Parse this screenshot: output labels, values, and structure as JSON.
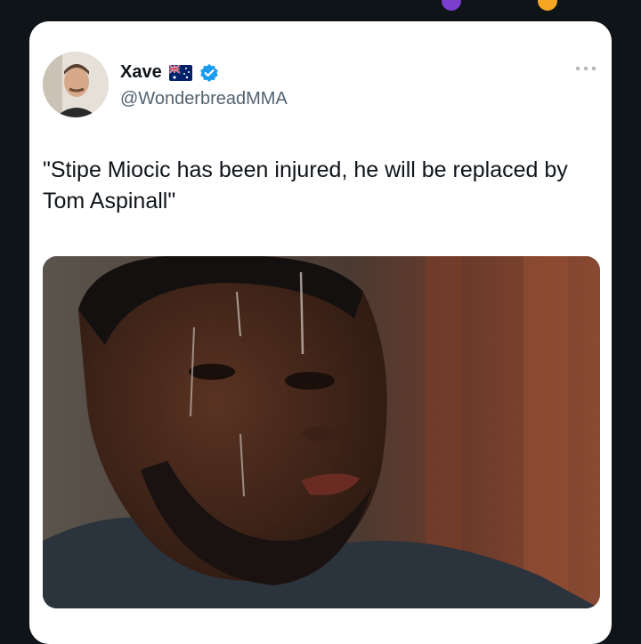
{
  "tweet": {
    "display_name": "Xave",
    "flag_emoji_icon": "australia-flag-icon",
    "verified_icon": "verified-badge-icon",
    "handle": "@WonderbreadMMA",
    "more_icon": "more-options-icon",
    "text": "\"Stipe Miocic has been injured, he will be replaced by Tom Aspinall\""
  },
  "colors": {
    "background": "#0f1419",
    "card": "#ffffff",
    "verified": "#1d9bf0",
    "handle_text": "#536471"
  }
}
